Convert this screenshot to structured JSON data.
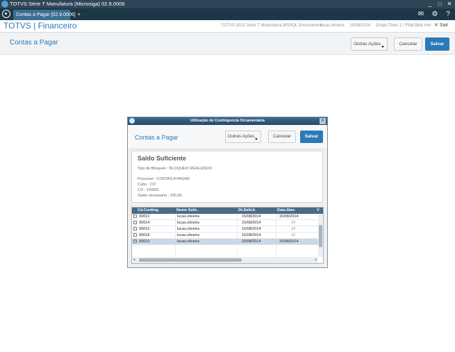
{
  "window": {
    "title": "TOTVS Série T Manufatura (Microsiga) 02.9.0006",
    "controls": [
      "_",
      "□",
      "✕"
    ]
  },
  "tabbar": {
    "tab_label": "Contas a Pagar [02.9.0006]",
    "tab_close": "×",
    "mail_icon": "✉",
    "gear_icon": "⚙",
    "help_icon": "?"
  },
  "header": {
    "brand": "TOTVS | Financeiro",
    "environment": "TOTVS 2012 Série T Manufatura MSSQL Environment",
    "user": "lucas.oliveira",
    "date": "15/08/2014",
    "branch": "Grupo Totvs 1 / Filial Belo Hor",
    "exit": "✕ Sair"
  },
  "page": {
    "title": "Contas a Pagar",
    "other_actions": "Outras Ações",
    "cancel": "Cancelar",
    "save": "Salvar"
  },
  "dialog": {
    "title": "Utilização de Contingencia Orcamentaria",
    "head_title": "Contas a Pagar",
    "other_actions": "Outras Ações",
    "cancel": "Cancelar",
    "save": "Salvar",
    "panel": {
      "heading": "Saldo Suficiente",
      "block_type": "Tipo de Bloqueio : BLOQUEIO REALIZADO",
      "process": "Processo : CONTAS A PAGAR",
      "cube": "Cubo : CO",
      "co": "CO : 100001",
      "required_balance": "Saldo necessario : 200,00"
    },
    "grid": {
      "columns": [
        "Cd.Conting.",
        "Nome Solic.",
        "Dt.Solicit.",
        "Data liber.",
        "V"
      ],
      "rows": [
        {
          "code": "00012",
          "name": "lucas.oliveira",
          "req_date": "15/08/2014",
          "rel_date": "15/08/2014",
          "checked": false,
          "selected": false
        },
        {
          "code": "00014",
          "name": "lucas.oliveira",
          "req_date": "15/08/2014",
          "rel_date": "/ /",
          "checked": false,
          "selected": false
        },
        {
          "code": "00015",
          "name": "lucas.oliveira",
          "req_date": "15/08/2014",
          "rel_date": "/ /",
          "checked": false,
          "selected": false
        },
        {
          "code": "00018",
          "name": "lucas.oliveira",
          "req_date": "15/08/2014",
          "rel_date": "/ /",
          "checked": false,
          "selected": false
        },
        {
          "code": "00019",
          "name": "lucas.oliveira",
          "req_date": "15/08/2014",
          "rel_date": "15/08/2014",
          "checked": true,
          "selected": true
        }
      ],
      "check_mark": "×",
      "scroll_left": "◂",
      "scroll_right": "▸"
    }
  },
  "colors": {
    "accent": "#2b7ab5",
    "window_bar": "#2f4659",
    "tab_bar": "#1e3747",
    "grid_header": "#4a6b86",
    "selected_row": "#c9d9ea"
  }
}
